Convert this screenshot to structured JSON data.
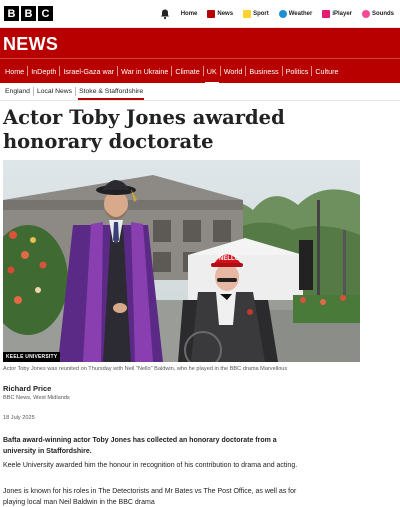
{
  "brand": {
    "letters": [
      "B",
      "B",
      "C"
    ]
  },
  "topnav": {
    "items": [
      {
        "label": "Home",
        "icon": "home-icon",
        "color": "#202224"
      },
      {
        "label": "News",
        "icon": "news-icon",
        "color": "#b80000"
      },
      {
        "label": "Sport",
        "icon": "sport-icon",
        "color": "#ffd230"
      },
      {
        "label": "Weather",
        "icon": "weather-icon",
        "color": "#1b8fd2"
      },
      {
        "label": "iPlayer",
        "icon": "iplayer-icon",
        "color": "#e61a74"
      },
      {
        "label": "Sounds",
        "icon": "sounds-icon",
        "color": "#f54996"
      }
    ]
  },
  "section": {
    "title": "NEWS",
    "nav": [
      "Home",
      "InDepth",
      "Israel-Gaza war",
      "War in Ukraine",
      "Climate",
      "UK",
      "World",
      "Business",
      "Politics",
      "Culture"
    ]
  },
  "subnav": [
    "England",
    "Local News",
    "Stoke & Staffordshire"
  ],
  "article": {
    "headline": "Actor Toby Jones awarded honorary doctorate",
    "image_credit": "KEELE UNIVERSITY",
    "caption": "Actor Toby Jones was reunited on Thursday with Neil \"Nello\" Baldwin, who he played in the BBC drama Marvellous",
    "author": "Richard Price",
    "author_role": "BBC News, West Midlands",
    "date": "18 July 2025",
    "paragraphs": [
      "Bafta award-winning actor Toby Jones has collected an honorary doctorate from a university in Staffordshire.",
      "Keele University awarded him the honour in recognition of his contribution to drama and acting.",
      "Jones is known for his roles in The Detectorists and Mr Bates vs The Post Office, as well as for playing local man Neil Baldwin in the BBC drama"
    ],
    "cap_text": "NELLO"
  },
  "colors": {
    "news_red": "#b80000",
    "text": "#202224",
    "muted": "#545658"
  }
}
